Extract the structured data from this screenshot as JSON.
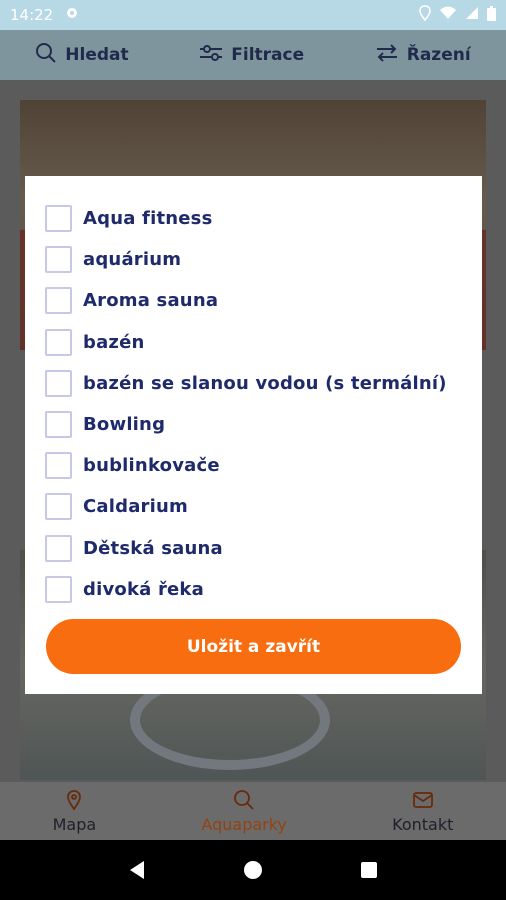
{
  "status_bar": {
    "time": "14:22"
  },
  "toolbar": {
    "search": "Hledat",
    "filter": "Filtrace",
    "sort": "Řazení"
  },
  "bottom_nav": {
    "map": "Mapa",
    "aquaparks": "Aquaparky",
    "contact": "Kontakt"
  },
  "dialog": {
    "options": [
      "Aqua fitness",
      "aquárium",
      "Aroma sauna",
      "bazén",
      "bazén se slanou vodou (s termální)",
      "Bowling",
      "bublinkovače",
      "Caldarium",
      "Dětská sauna",
      "divoká řeka"
    ],
    "save_label": "Uložit a zavřít"
  },
  "colors": {
    "accent": "#f76d10",
    "text": "#1f2a6b",
    "checkbox_border": "#c7c8e8"
  }
}
